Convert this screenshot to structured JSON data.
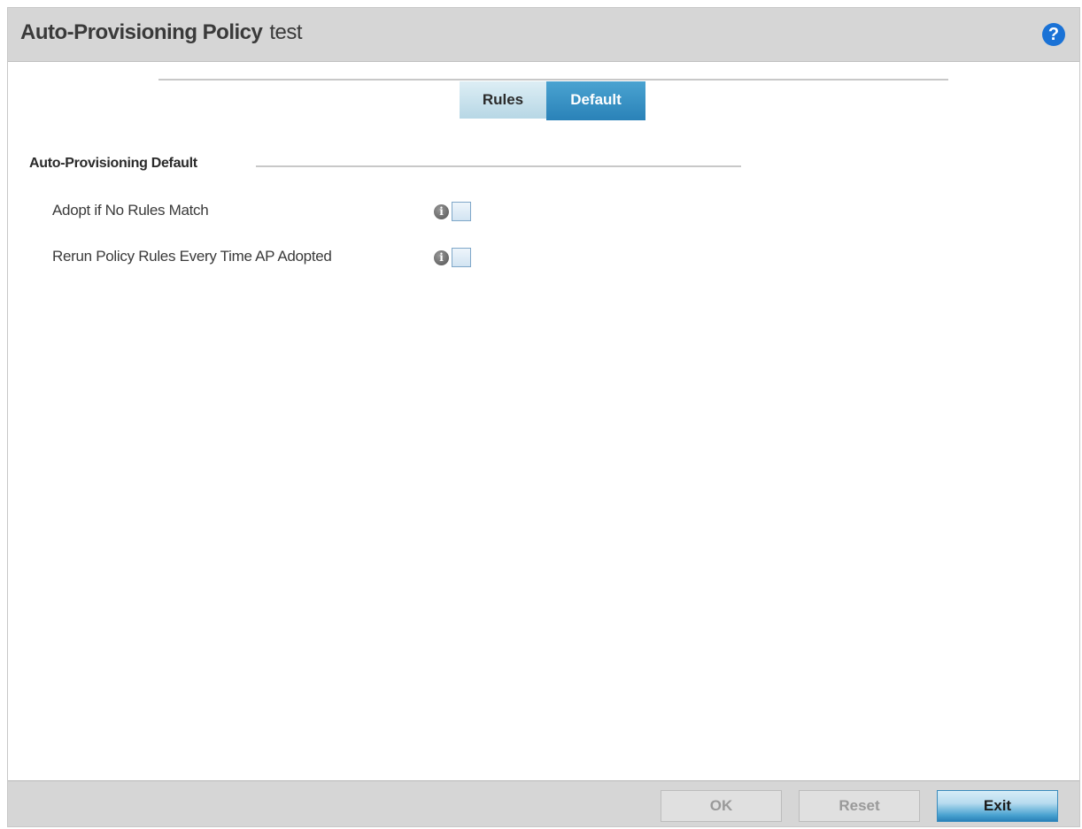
{
  "window": {
    "title": "Auto-Provisioning Policy",
    "subtitle": "test"
  },
  "tabs": [
    {
      "label": "Rules",
      "active": false
    },
    {
      "label": "Default",
      "active": true
    }
  ],
  "section": {
    "title": "Auto-Provisioning Default",
    "options": [
      {
        "label": "Adopt if No Rules Match",
        "checked": false
      },
      {
        "label": "Rerun Policy Rules Every Time AP Adopted",
        "checked": false
      }
    ]
  },
  "footer": {
    "ok_label": "OK",
    "reset_label": "Reset",
    "exit_label": "Exit"
  },
  "colors": {
    "accent": "#2a82b8",
    "help": "#1a72d6",
    "titlebar": "#d6d6d6"
  }
}
